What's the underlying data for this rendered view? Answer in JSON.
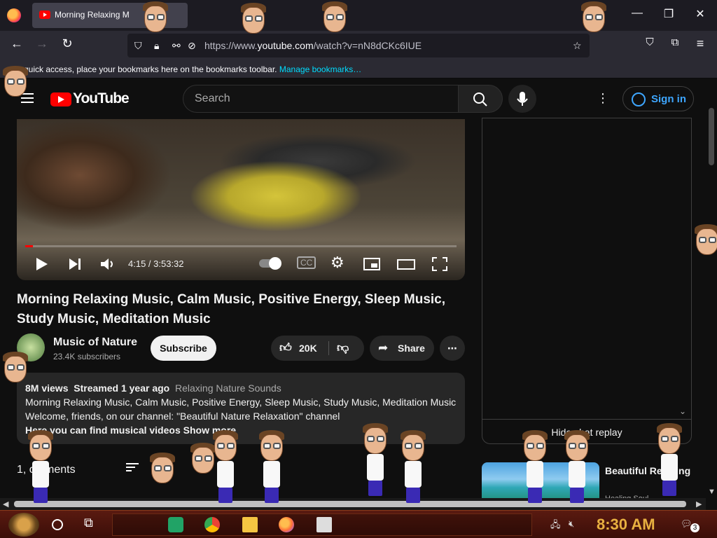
{
  "browser": {
    "tab_title": "Morning Relaxing M",
    "url_prefix": "https://www.",
    "url_domain": "youtube.com",
    "url_path": "/watch?v=nN8dCKc6IUE",
    "bookmarks_text": "quick access, place your bookmarks here on the bookmarks toolbar.",
    "bookmarks_link": "Manage bookmarks…",
    "minimize": "—",
    "maximize": "❐",
    "close": "✕"
  },
  "youtube": {
    "logo_text": "YouTube",
    "search_placeholder": "Search",
    "sign_in": "Sign in",
    "player": {
      "time": "4:15 / 3:53:32",
      "progress_fraction": 0.018
    },
    "title": "Morning Relaxing Music, Calm Music, Positive Energy, Sleep Music, Study Music, Meditation Music",
    "channel": {
      "name": "Music of Nature",
      "subscribers": "23.4K subscribers",
      "subscribe": "Subscribe"
    },
    "actions": {
      "likes": "20K",
      "share": "Share",
      "more": "⋯"
    },
    "description": {
      "views": "8M views",
      "streamed": "Streamed 1 year ago",
      "tag": "Relaxing Nature Sounds",
      "line1": "Morning Relaxing Music, Calm Music, Positive Energy, Sleep Music, Study Music, Meditation Music",
      "line2": "Welcome, friends, on our channel: \"Beautiful Nature Relaxation\" channel",
      "line3": "Here you can find musical videos",
      "show_more": "Show more"
    },
    "comments": "1,  omments",
    "chat": {
      "hide_replay": "Hide chat replay"
    },
    "recommendation": {
      "title": "Beautiful Relaxing",
      "channel": "Healing Soul"
    }
  },
  "taskbar": {
    "clock": "8:30 AM",
    "notification_count": "3"
  }
}
